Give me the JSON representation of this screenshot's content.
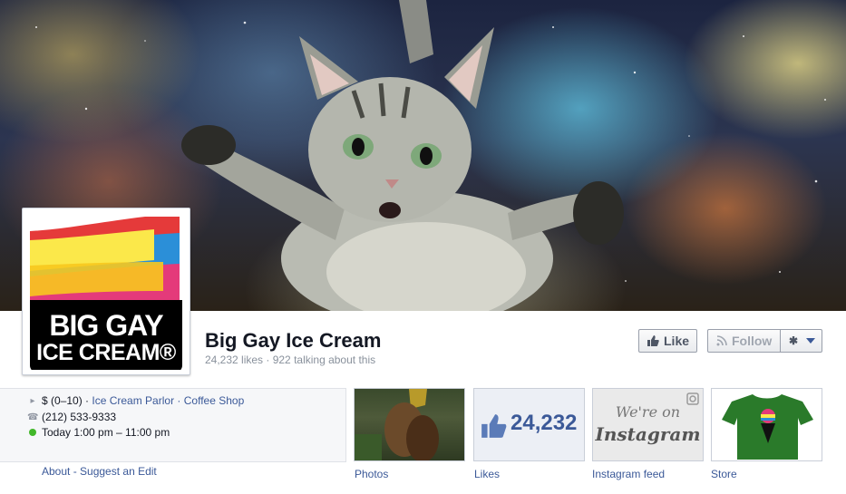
{
  "page": {
    "name": "Big Gay Ice Cream",
    "stats": "24,232 likes · 922 talking about this"
  },
  "logo": {
    "line1": "BIG GAY",
    "line2": "ICE CREAM®",
    "stripe_colors": [
      "#fbe84a",
      "#2b8fd8",
      "#e43a7a",
      "#e53a3a",
      "#f7c81e"
    ]
  },
  "actions": {
    "like_label": "Like",
    "follow_label": "Follow",
    "gear_icon": "gear-icon"
  },
  "about": {
    "price": "$ (0–10) ·",
    "categories": [
      "Ice Cream Parlor",
      "Coffee Shop"
    ],
    "category_sep": " · ",
    "phone": "(212) 533-9333",
    "hours": "Today 1:00 pm – 11:00 pm",
    "about_link": "About",
    "link_sep": " - ",
    "suggest_link": "Suggest an Edit"
  },
  "apps": [
    {
      "label": "Photos"
    },
    {
      "label": "Likes",
      "count": "24,232"
    },
    {
      "label": "Instagram feed",
      "line1": "We're on",
      "line2": "Instagram"
    },
    {
      "label": "Store"
    }
  ],
  "colors": {
    "link": "#3b5998",
    "name": "#141823",
    "muted": "#89919c",
    "open_now": "#42b72a"
  }
}
